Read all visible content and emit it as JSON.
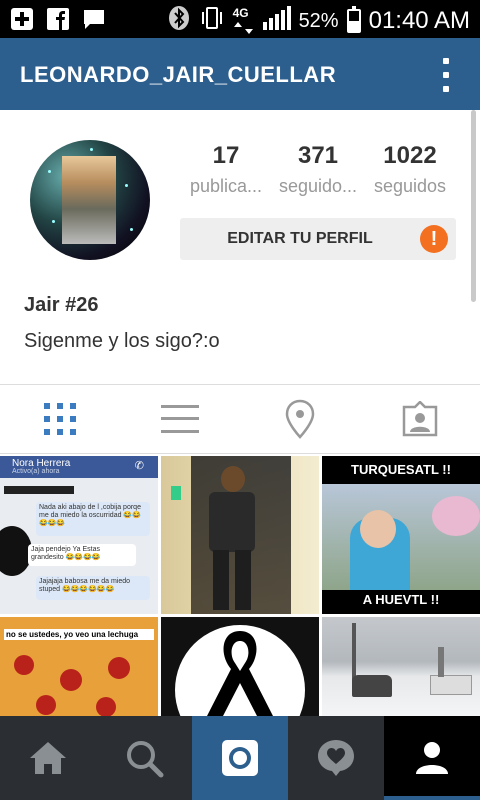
{
  "status_bar": {
    "battery_text": "52%",
    "battery_level": 0.52,
    "time": "01:40 AM",
    "network": "4G",
    "icons": [
      "plus-box-icon",
      "facebook-icon",
      "message-icon",
      "bluetooth-icon",
      "vibrate-icon",
      "network-4g-icon",
      "signal-icon",
      "battery-icon"
    ]
  },
  "header": {
    "username": "LEONARDO_JAIR_CUELLAR",
    "menu_icon": "overflow-menu-icon",
    "background": "#2d5f8e"
  },
  "profile": {
    "stats": [
      {
        "value": "17",
        "label": "publica..."
      },
      {
        "value": "371",
        "label": "seguido..."
      },
      {
        "value": "1022",
        "label": "seguidos"
      }
    ],
    "edit_button_label": "EDITAR TU PERFIL",
    "alert_symbol": "!",
    "alert_color": "#f37021",
    "full_name": "Jair #26",
    "bio": "Sigenme y los sigo?:o"
  },
  "tabs": [
    {
      "name": "grid-view-icon",
      "active": true
    },
    {
      "name": "list-view-icon",
      "active": false
    },
    {
      "name": "location-pin-icon",
      "active": false
    },
    {
      "name": "tagged-photos-icon",
      "active": false
    }
  ],
  "grid_posts": {
    "post1": {
      "contact_name": "Nora Herrera",
      "contact_status": "Activo(a) ahora",
      "messages": [
        "Nada aki abajo de l ,cobija porqe me da miedo la oscurridad 😂😂😂😂😂",
        "Jaja pendejo Ya Estas grandesito 😂😂😂😂",
        "Jajajaja babosa me da miedo stuped 😂😂😂😂😂😂"
      ]
    },
    "post3": {
      "top_text": "TURQUESATL !!",
      "bottom_text": "A HUEVTL !!"
    },
    "post4": {
      "caption": "no se ustedes, yo veo una lechuga"
    }
  },
  "bottom_nav": [
    {
      "name": "home-icon",
      "active": false
    },
    {
      "name": "search-icon",
      "active": false
    },
    {
      "name": "camera-icon",
      "active": false
    },
    {
      "name": "activity-heart-icon",
      "active": false
    },
    {
      "name": "profile-icon",
      "active": true
    }
  ],
  "colors": {
    "accent": "#2d5f8e",
    "nav_bg": "#2b2f33",
    "alert": "#f37021",
    "tab_active": "#3b7bbf"
  }
}
